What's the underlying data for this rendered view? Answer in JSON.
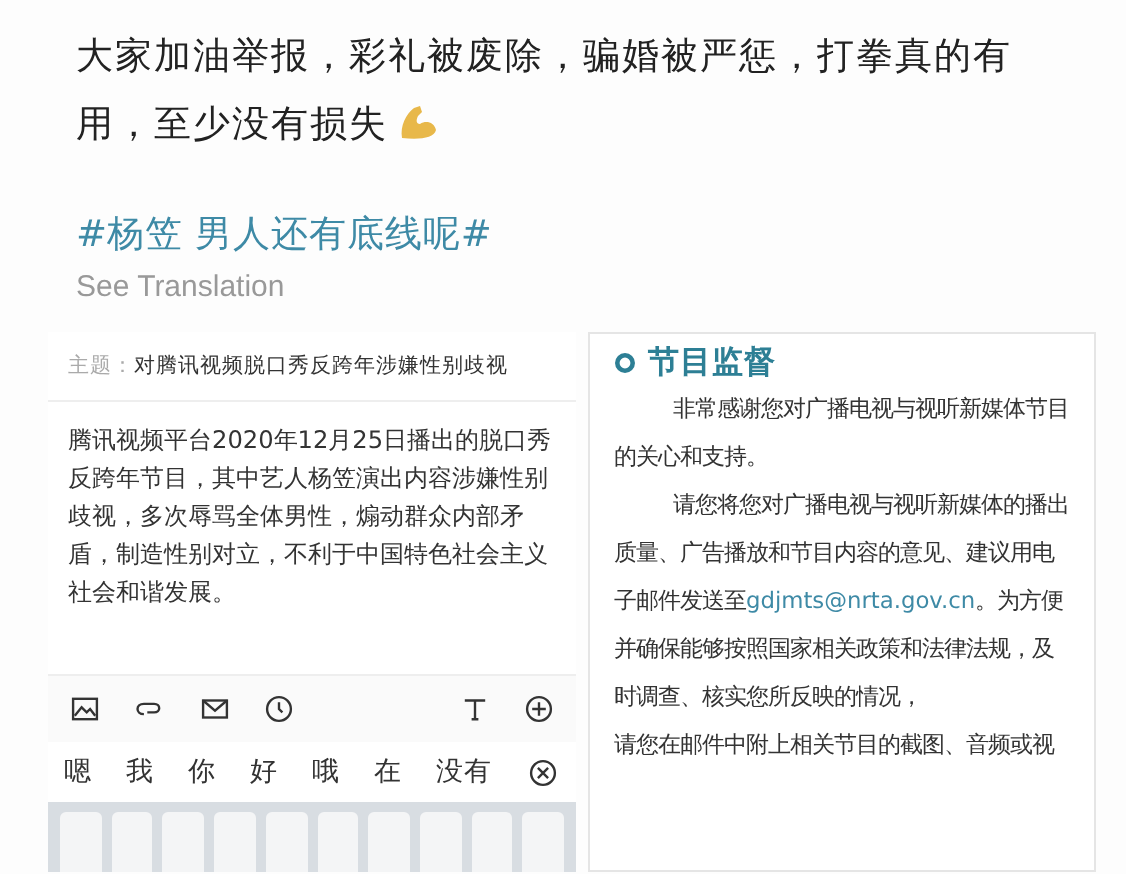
{
  "post": {
    "text": "大家加油举报，彩礼被废除，骗婚被严惩，打拳真的有用，至少没有损失",
    "hashtag": "#杨笠 男人还有底线呢#",
    "translate_link": "See Translation"
  },
  "email_draft": {
    "subject_label": "主题：",
    "subject": "对腾讯视频脱口秀反跨年涉嫌性别歧视",
    "body": "腾讯视频平台2020年12月25日播出的脱口秀反跨年节目，其中艺人杨笠演出内容涉嫌性别歧视，多次辱骂全体男性，煽动群众内部矛盾，制造性别对立，不利于中国特色社会主义社会和谐发展。",
    "candidates": [
      "嗯",
      "我",
      "你",
      "好",
      "哦",
      "在",
      "没有"
    ]
  },
  "notice": {
    "title": "节目监督",
    "paragraphs": [
      {
        "text": "非常感谢您对广播电视与视听新媒体节目的关心和支持。",
        "indent": true
      },
      {
        "text": "请您将您对广播电视与视听新媒体的播出质量、广告播放和节目内容的意见、建议用电子邮件发送至",
        "email": "gdjmts@nrta.gov.cn",
        "after": "。为方便并确保能够按照国家相关政策和法律法规，及时调查、核实您所反映的情况，",
        "indent": true
      },
      {
        "text": "请您在邮件中附上相关节目的截图、音频或视",
        "indent": false
      }
    ]
  }
}
